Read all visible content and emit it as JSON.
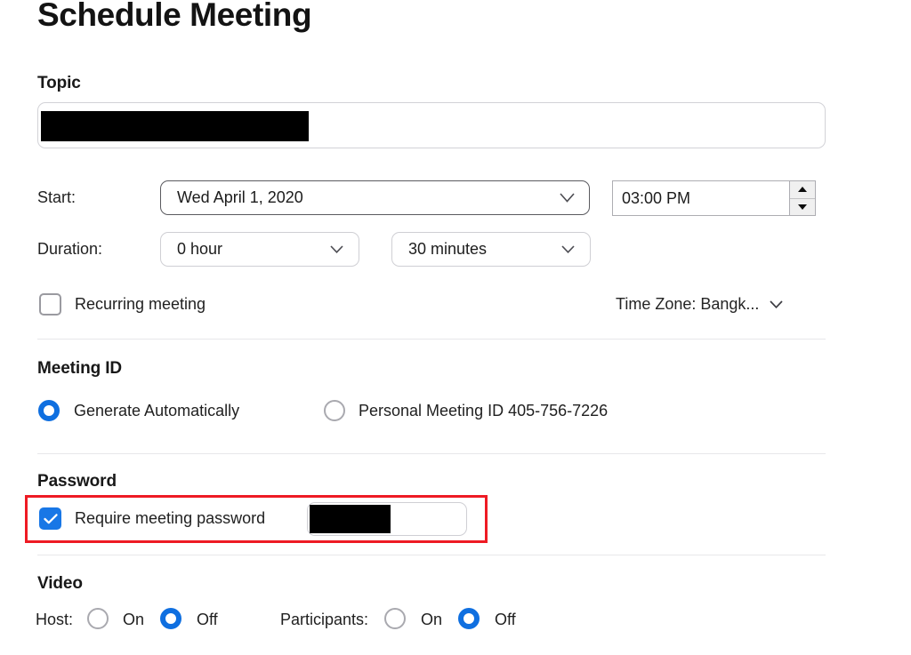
{
  "window": {
    "title": "Schedule Meeting"
  },
  "topic": {
    "label": "Topic",
    "value": "",
    "redacted": true
  },
  "start": {
    "label": "Start:",
    "date_value": "Wed  April 1, 2020",
    "time_value": "03:00 PM",
    "date_chevron_icon": "chevron-down-icon",
    "time_spinner_up_icon": "triangle-up-icon",
    "time_spinner_down_icon": "triangle-down-icon"
  },
  "duration": {
    "label": "Duration:",
    "hours_value": "0 hour",
    "minutes_value": "30 minutes",
    "chevron_icon": "chevron-down-icon"
  },
  "recurring": {
    "label": "Recurring meeting",
    "checked": false
  },
  "timezone": {
    "text": "Time Zone: Bangk...",
    "chevron_icon": "chevron-down-icon"
  },
  "meeting_id": {
    "section_label": "Meeting ID",
    "options": [
      {
        "label": "Generate Automatically",
        "selected": true
      },
      {
        "label": "Personal Meeting ID 405-756-7226",
        "selected": false
      }
    ]
  },
  "password": {
    "section_label": "Password",
    "require_label": "Require meeting password",
    "checked": true,
    "value": "",
    "redacted": true,
    "highlight_color": "#ee1b24"
  },
  "video": {
    "section_label": "Video",
    "host": {
      "label": "Host:",
      "on_label": "On",
      "off_label": "Off",
      "selected": "Off"
    },
    "participants": {
      "label": "Participants:",
      "on_label": "On",
      "off_label": "Off",
      "selected": "Off"
    }
  },
  "colors": {
    "accent_blue": "#0f6fe0",
    "checkbox_blue": "#1877e6",
    "highlight_red": "#ee1b24",
    "text": "#1f1f1f",
    "border": "#cfcfd4"
  }
}
